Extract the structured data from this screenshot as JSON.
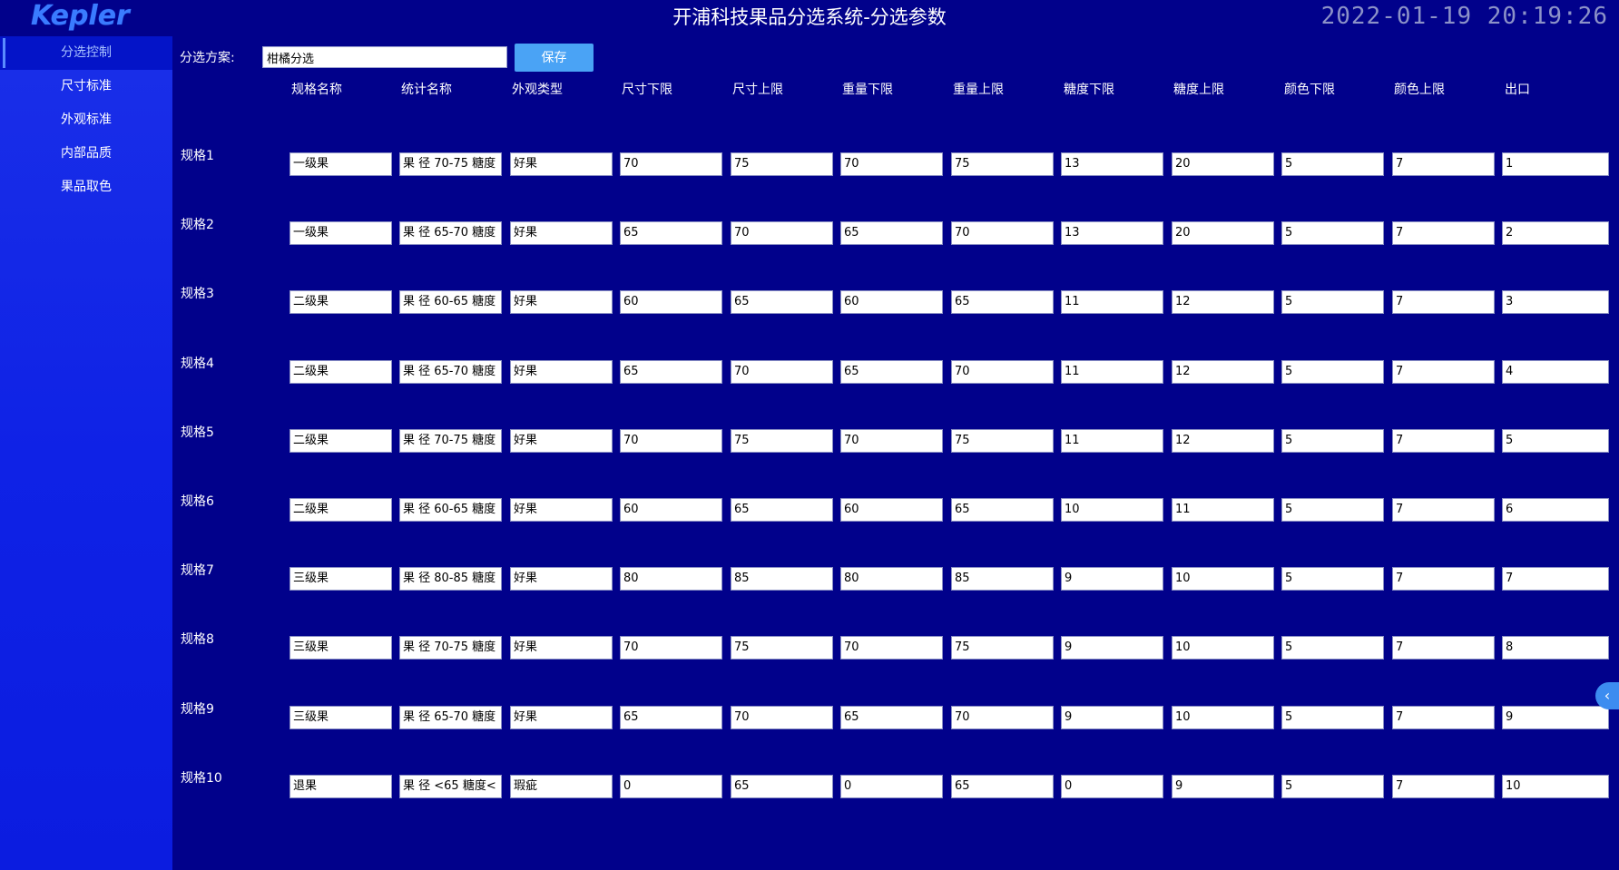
{
  "header": {
    "logo_text": "Kepler",
    "title": "开浦科技果品分选系统-分选参数",
    "datetime": "2022-01-19 20:19:26"
  },
  "sidebar": {
    "items": [
      {
        "label": "分选控制",
        "active": true
      },
      {
        "label": "尺寸标准",
        "active": false
      },
      {
        "label": "外观标准",
        "active": false
      },
      {
        "label": "内部品质",
        "active": false
      },
      {
        "label": "果品取色",
        "active": false
      }
    ]
  },
  "scheme": {
    "label": "分选方案:",
    "value": "柑橘分选",
    "save_label": "保存"
  },
  "table": {
    "columns": [
      "规格名称",
      "统计名称",
      "外观类型",
      "尺寸下限",
      "尺寸上限",
      "重量下限",
      "重量上限",
      "糖度下限",
      "糖度上限",
      "颜色下限",
      "颜色上限",
      "出口"
    ],
    "rows": [
      {
        "label": "规格1",
        "cells": [
          "一级果",
          "果 径 70-75 糖度",
          "好果",
          "70",
          "75",
          "70",
          "75",
          "13",
          "20",
          "5",
          "7",
          "1"
        ]
      },
      {
        "label": "规格2",
        "cells": [
          "一级果",
          "果 径 65-70 糖度",
          "好果",
          "65",
          "70",
          "65",
          "70",
          "13",
          "20",
          "5",
          "7",
          "2"
        ]
      },
      {
        "label": "规格3",
        "cells": [
          "二级果",
          "果 径 60-65 糖度",
          "好果",
          "60",
          "65",
          "60",
          "65",
          "11",
          "12",
          "5",
          "7",
          "3"
        ]
      },
      {
        "label": "规格4",
        "cells": [
          "二级果",
          "果 径 65-70 糖度",
          "好果",
          "65",
          "70",
          "65",
          "70",
          "11",
          "12",
          "5",
          "7",
          "4"
        ]
      },
      {
        "label": "规格5",
        "cells": [
          "二级果",
          "果 径 70-75 糖度",
          "好果",
          "70",
          "75",
          "70",
          "75",
          "11",
          "12",
          "5",
          "7",
          "5"
        ]
      },
      {
        "label": "规格6",
        "cells": [
          "二级果",
          "果 径 60-65 糖度",
          "好果",
          "60",
          "65",
          "60",
          "65",
          "10",
          "11",
          "5",
          "7",
          "6"
        ]
      },
      {
        "label": "规格7",
        "cells": [
          "三级果",
          "果 径 80-85 糖度",
          "好果",
          "80",
          "85",
          "80",
          "85",
          "9",
          "10",
          "5",
          "7",
          "7"
        ]
      },
      {
        "label": "规格8",
        "cells": [
          "三级果",
          "果 径 70-75 糖度",
          "好果",
          "70",
          "75",
          "70",
          "75",
          "9",
          "10",
          "5",
          "7",
          "8"
        ]
      },
      {
        "label": "规格9",
        "cells": [
          "三级果",
          "果 径 65-70 糖度",
          "好果",
          "65",
          "70",
          "65",
          "70",
          "9",
          "10",
          "5",
          "7",
          "9"
        ]
      },
      {
        "label": "规格10",
        "cells": [
          "退果",
          "果 径 <65 糖度<",
          "瑕疵",
          "0",
          "65",
          "0",
          "65",
          "0",
          "9",
          "5",
          "7",
          "10"
        ]
      }
    ]
  },
  "collapse_handle": {
    "icon": "chevron-left-icon",
    "glyph": "‹"
  }
}
